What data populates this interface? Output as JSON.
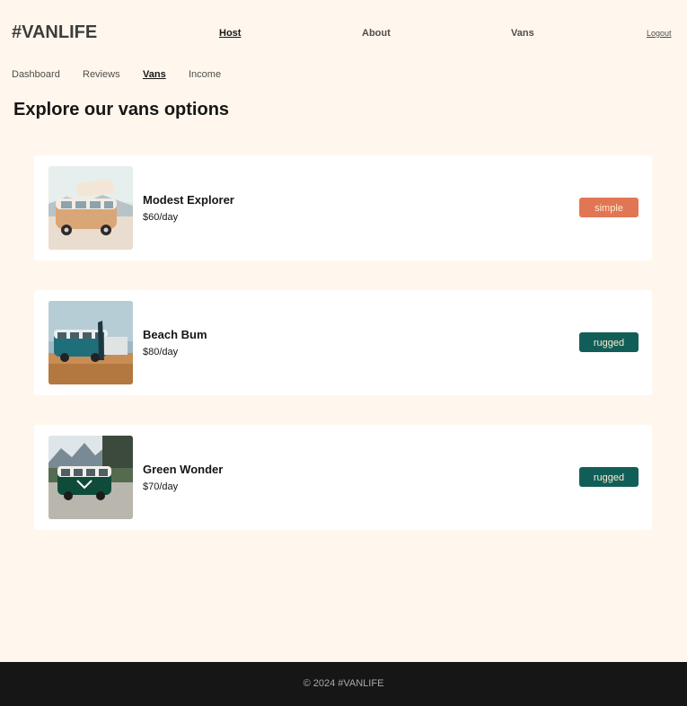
{
  "header": {
    "logo": "#VANLIFE",
    "nav": {
      "host": "Host",
      "about": "About",
      "vans": "Vans"
    },
    "logout": "Logout"
  },
  "subnav": {
    "dashboard": "Dashboard",
    "reviews": "Reviews",
    "vans": "Vans",
    "income": "Income"
  },
  "page_title": "Explore our vans options",
  "vans": [
    {
      "name": "Modest Explorer",
      "price": "$60/day",
      "type": "simple",
      "type_color": "#e17654",
      "image": "van-photo-beige"
    },
    {
      "name": "Beach Bum",
      "price": "$80/day",
      "type": "rugged",
      "type_color": "#115e59",
      "image": "van-photo-teal"
    },
    {
      "name": "Green Wonder",
      "price": "$70/day",
      "type": "rugged",
      "type_color": "#115e59",
      "image": "van-photo-green"
    }
  ],
  "footer": {
    "copyright": "© 2024 #VANLIFE"
  }
}
